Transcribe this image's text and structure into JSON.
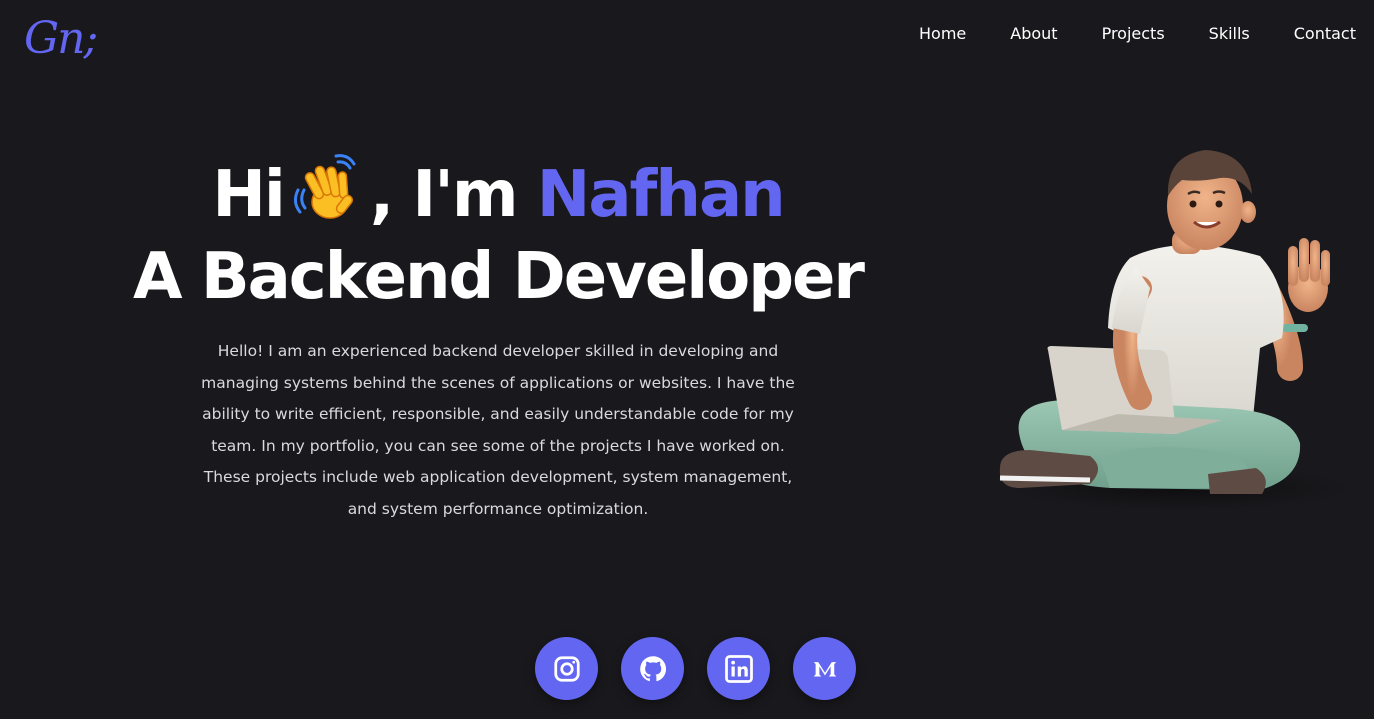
{
  "logo": {
    "text": "Gn;"
  },
  "nav": {
    "items": [
      {
        "label": "Home"
      },
      {
        "label": "About"
      },
      {
        "label": "Projects"
      },
      {
        "label": "Skills"
      },
      {
        "label": "Contact"
      }
    ]
  },
  "hero": {
    "greeting_hi": "Hi",
    "greeting_im": ", I'm",
    "name": "Nafhan",
    "role": "A Backend Developer",
    "wave_icon": "waving-hand-icon",
    "intro": "Hello! I am an experienced backend developer skilled in developing and managing systems behind the scenes of applications or websites. I have the ability to write efficient, responsible, and easily understandable code for my team. In my portfolio, you can see some of the projects I have worked on. These projects include web application development, system management, and system performance optimization."
  },
  "illustration": {
    "icon": "developer-avatar-illustration"
  },
  "socials": [
    {
      "icon": "instagram-icon"
    },
    {
      "icon": "github-icon"
    },
    {
      "icon": "linkedin-icon"
    },
    {
      "icon": "medium-icon"
    }
  ],
  "colors": {
    "background": "#19181c",
    "accent": "#6366f1",
    "text": "#ffffff",
    "muted_text": "#d9d9de"
  }
}
